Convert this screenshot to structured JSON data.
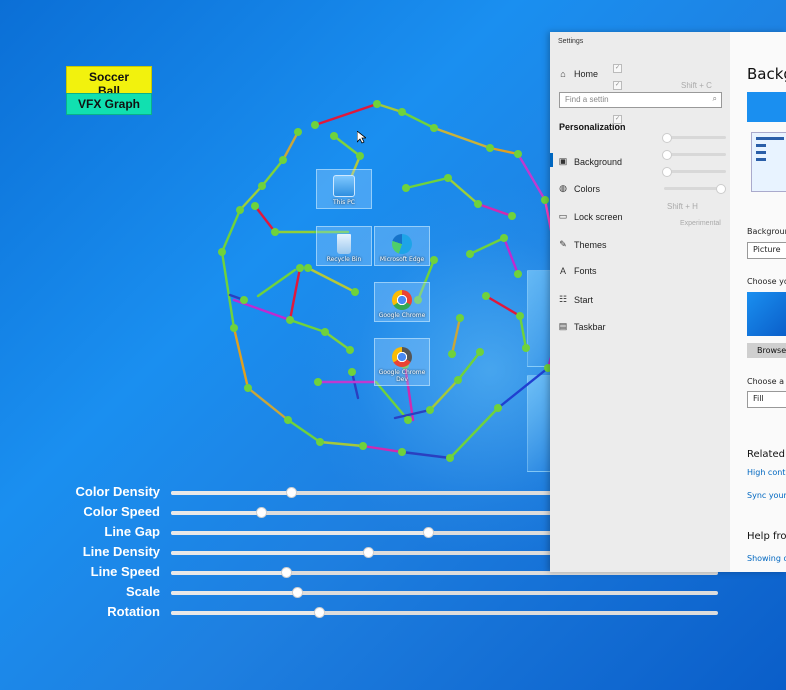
{
  "badges": {
    "soccer": "Soccer Ball",
    "vfx": "VFX Graph"
  },
  "desktop_icons": [
    {
      "label": "This PC",
      "icon": "computer-icon"
    },
    {
      "label": "Recycle Bin",
      "icon": "recycle-bin-icon"
    },
    {
      "label": "Microsoft Edge",
      "icon": "edge-icon"
    },
    {
      "label": "Google Chrome",
      "icon": "chrome-icon"
    },
    {
      "label": "Google Chrome Dev",
      "icon": "chrome-dev-icon"
    }
  ],
  "sliders": [
    {
      "label": "Color Density",
      "value": 0.22
    },
    {
      "label": "Color Speed",
      "value": 0.165
    },
    {
      "label": "Line Gap",
      "value": 0.47
    },
    {
      "label": "Line Density",
      "value": 0.36
    },
    {
      "label": "Line Speed",
      "value": 0.21
    },
    {
      "label": "Scale",
      "value": 0.23
    },
    {
      "label": "Rotation",
      "value": 0.27
    }
  ],
  "settings": {
    "title": "Settings",
    "home": "Home",
    "search_placeholder": "Find a settin",
    "section": "Personalization",
    "nav": [
      {
        "label": "Background",
        "icon": "image-icon"
      },
      {
        "label": "Colors",
        "icon": "palette-icon"
      },
      {
        "label": "Lock screen",
        "icon": "lock-screen-icon"
      },
      {
        "label": "Themes",
        "icon": "themes-icon"
      },
      {
        "label": "Fonts",
        "icon": "fonts-icon"
      },
      {
        "label": "Start",
        "icon": "start-icon"
      },
      {
        "label": "Taskbar",
        "icon": "taskbar-icon"
      }
    ],
    "overlay_shortcut_1": "Shift + C",
    "overlay_shortcut_2": "Shift + H",
    "overlay_experimental": "Experimental",
    "right": {
      "heading": "Backg",
      "background_label": "Backgroun",
      "background_value": "Picture",
      "choose_picture": "Choose yo",
      "browse": "Browse",
      "choose_fit": "Choose a f",
      "fit_value": "Fill",
      "related": "Related",
      "link_contrast": "High contr",
      "link_sync": "Sync your",
      "help": "Help fro",
      "link_showing": "Showing o"
    }
  },
  "colors": {
    "accent": "#0067c0",
    "node": "#6fd23c",
    "badge_yellow": "#f2f20d",
    "badge_teal": "#11e0b0"
  }
}
